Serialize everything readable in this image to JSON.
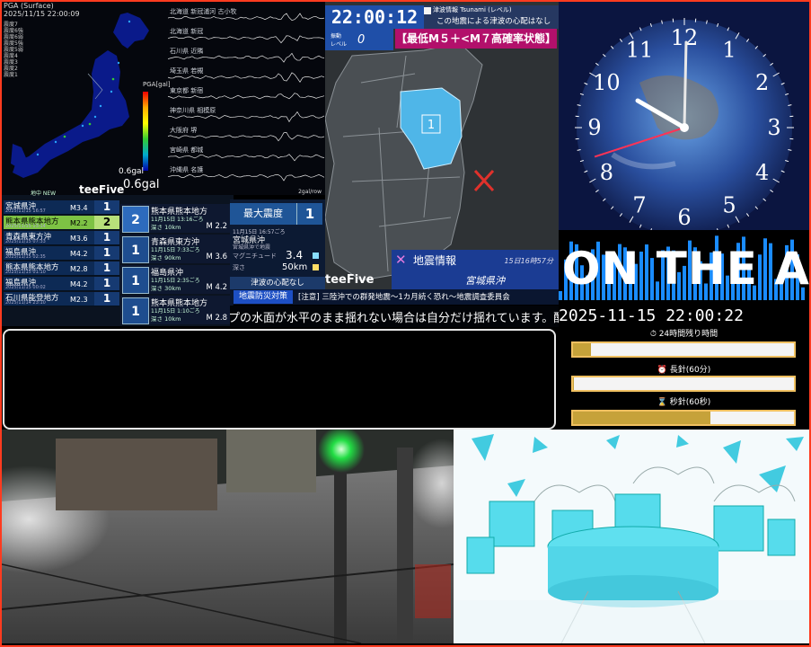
{
  "seismo": {
    "header": "PGA (Surface)\n2025/11/15 22:00:09",
    "legend": [
      "震度7",
      "震度6強",
      "震度6弱",
      "震度5強",
      "震度5弱",
      "震度4",
      "震度3",
      "震度2",
      "震度1"
    ],
    "pga_label": "PGA[gal]",
    "gal_small": "0.6gal",
    "gal_large": "0.6gal",
    "ymax": "2gal/row",
    "map_label": "",
    "stations": [
      "北海道 新冠浦河 古小牧",
      "北海道 新冠",
      "石川県 近隣",
      "埼玉県 若槻",
      "東京都 新宿",
      "神奈川県 相模原",
      "大阪府 堺",
      "宮崎県 都城",
      "沖縄県 名護"
    ]
  },
  "quakes": {
    "logo": "teeFive",
    "header": "地中 NEW",
    "list": [
      {
        "place": "宮城県沖",
        "date": "2025/11/15 16:57",
        "mag": "M3.4",
        "int": "1",
        "hl": false
      },
      {
        "place": "熊本県熊本地方",
        "date": "2025/11/15 13:14",
        "mag": "M2.2",
        "int": "2",
        "hl": true
      },
      {
        "place": "青森県東方沖",
        "date": "2025/11/15 07:33",
        "mag": "M3.6",
        "int": "1",
        "hl": false
      },
      {
        "place": "福島県沖",
        "date": "2025/11/15 02:35",
        "mag": "M4.2",
        "int": "1",
        "hl": false
      },
      {
        "place": "熊本県熊本地方",
        "date": "2025/11/15 01:10",
        "mag": "M2.8",
        "int": "1",
        "hl": false
      },
      {
        "place": "福島県沖",
        "date": "2025/11/15 00:02",
        "mag": "M4.2",
        "int": "1",
        "hl": false
      },
      {
        "place": "石川県能登地方",
        "date": "2025/11/14 23:10",
        "mag": "M2.3",
        "int": "1",
        "hl": false
      }
    ],
    "details": [
      {
        "int": "2",
        "place": "熊本県熊本地方",
        "time": "11月15日 13:16ごろ",
        "depth": "深さ 10km",
        "mag": "M 2.2"
      },
      {
        "int": "1",
        "place": "青森県東方沖",
        "time": "11月15日 7:33ごろ",
        "depth": "深さ 90km",
        "mag": "M 3.6"
      },
      {
        "int": "1",
        "place": "福島県沖",
        "time": "11月15日 2:35ごろ",
        "depth": "深さ 30km",
        "mag": "M 4.2"
      },
      {
        "int": "1",
        "place": "熊本県熊本地方",
        "time": "11月15日 1:10ごろ",
        "depth": "深さ 10km",
        "mag": "M 2.8"
      }
    ]
  },
  "summary": {
    "max_label": "最大震度",
    "max_value": "1",
    "time": "11月15日 16:57ごろ",
    "place": "宮城県沖",
    "sub": "宮城県沖で地震",
    "mag_label": "マグニチュード",
    "mag_value": "3.4",
    "depth_label": "深さ",
    "depth_value": "50km",
    "tsunami": "津波の心配なし"
  },
  "ticker": {
    "tag": "地震防災対策",
    "headline": "[注意] 三陸沖での群発地震～1カ月続く恐れ～地震調査委員会",
    "scroll": "プの水面が水平のまま揺れない場合は自分だけ揺れています。酷い場合"
  },
  "map": {
    "clock": "22:00:12",
    "level_label1": "振動",
    "level_label2": "レベル",
    "level_value": "0",
    "tsunami_line1": "津波情報 Tsunami (レベル)",
    "tsunami_line2": "この地震による津波の心配はなし",
    "risk": "【最低M５＋<M７高確率状態】",
    "region_int": "1",
    "info_title": "地震情報",
    "info_date": "15日16時57分",
    "info_place": "宮城県沖",
    "logo": "teeFive"
  },
  "clock": {
    "numbers": [
      "12",
      "1",
      "2",
      "3",
      "4",
      "5",
      "6",
      "7",
      "8",
      "9",
      "10",
      "11"
    ],
    "hour": 10.0,
    "minute": 0.2,
    "second": 12
  },
  "onair": {
    "text": "ON THE AIR"
  },
  "timer": {
    "timestamp": "2025-11-15 22:00:22",
    "bars": [
      {
        "label": "⏱ 24時間残り時間",
        "fill": 0.08
      },
      {
        "label": "⏰ 長針(60分)",
        "fill": 0.003
      },
      {
        "label": "⌛ 秒針(60秒)",
        "fill": 0.62
      }
    ]
  },
  "colors": {
    "frame": "#ff3b1f",
    "accent_blue": "#1f4fa8",
    "risk_magenta": "#b2106b",
    "highlight_green": "#7dc244"
  }
}
